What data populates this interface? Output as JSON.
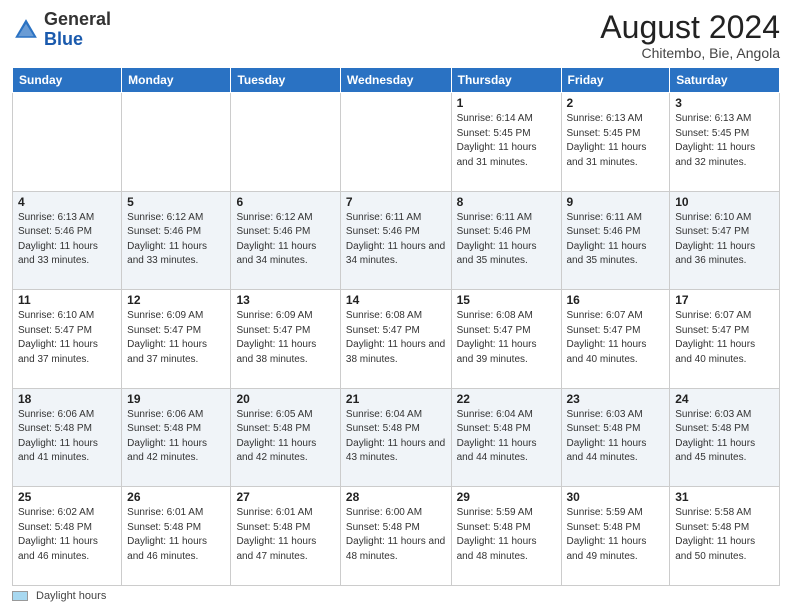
{
  "header": {
    "logo_line1": "General",
    "logo_line2": "Blue",
    "month_year": "August 2024",
    "location": "Chitembo, Bie, Angola"
  },
  "days_of_week": [
    "Sunday",
    "Monday",
    "Tuesday",
    "Wednesday",
    "Thursday",
    "Friday",
    "Saturday"
  ],
  "weeks": [
    [
      {
        "day": "",
        "info": ""
      },
      {
        "day": "",
        "info": ""
      },
      {
        "day": "",
        "info": ""
      },
      {
        "day": "",
        "info": ""
      },
      {
        "day": "1",
        "info": "Sunrise: 6:14 AM\nSunset: 5:45 PM\nDaylight: 11 hours\nand 31 minutes."
      },
      {
        "day": "2",
        "info": "Sunrise: 6:13 AM\nSunset: 5:45 PM\nDaylight: 11 hours\nand 31 minutes."
      },
      {
        "day": "3",
        "info": "Sunrise: 6:13 AM\nSunset: 5:45 PM\nDaylight: 11 hours\nand 32 minutes."
      }
    ],
    [
      {
        "day": "4",
        "info": "Sunrise: 6:13 AM\nSunset: 5:46 PM\nDaylight: 11 hours\nand 33 minutes."
      },
      {
        "day": "5",
        "info": "Sunrise: 6:12 AM\nSunset: 5:46 PM\nDaylight: 11 hours\nand 33 minutes."
      },
      {
        "day": "6",
        "info": "Sunrise: 6:12 AM\nSunset: 5:46 PM\nDaylight: 11 hours\nand 34 minutes."
      },
      {
        "day": "7",
        "info": "Sunrise: 6:11 AM\nSunset: 5:46 PM\nDaylight: 11 hours\nand 34 minutes."
      },
      {
        "day": "8",
        "info": "Sunrise: 6:11 AM\nSunset: 5:46 PM\nDaylight: 11 hours\nand 35 minutes."
      },
      {
        "day": "9",
        "info": "Sunrise: 6:11 AM\nSunset: 5:46 PM\nDaylight: 11 hours\nand 35 minutes."
      },
      {
        "day": "10",
        "info": "Sunrise: 6:10 AM\nSunset: 5:47 PM\nDaylight: 11 hours\nand 36 minutes."
      }
    ],
    [
      {
        "day": "11",
        "info": "Sunrise: 6:10 AM\nSunset: 5:47 PM\nDaylight: 11 hours\nand 37 minutes."
      },
      {
        "day": "12",
        "info": "Sunrise: 6:09 AM\nSunset: 5:47 PM\nDaylight: 11 hours\nand 37 minutes."
      },
      {
        "day": "13",
        "info": "Sunrise: 6:09 AM\nSunset: 5:47 PM\nDaylight: 11 hours\nand 38 minutes."
      },
      {
        "day": "14",
        "info": "Sunrise: 6:08 AM\nSunset: 5:47 PM\nDaylight: 11 hours\nand 38 minutes."
      },
      {
        "day": "15",
        "info": "Sunrise: 6:08 AM\nSunset: 5:47 PM\nDaylight: 11 hours\nand 39 minutes."
      },
      {
        "day": "16",
        "info": "Sunrise: 6:07 AM\nSunset: 5:47 PM\nDaylight: 11 hours\nand 40 minutes."
      },
      {
        "day": "17",
        "info": "Sunrise: 6:07 AM\nSunset: 5:47 PM\nDaylight: 11 hours\nand 40 minutes."
      }
    ],
    [
      {
        "day": "18",
        "info": "Sunrise: 6:06 AM\nSunset: 5:48 PM\nDaylight: 11 hours\nand 41 minutes."
      },
      {
        "day": "19",
        "info": "Sunrise: 6:06 AM\nSunset: 5:48 PM\nDaylight: 11 hours\nand 42 minutes."
      },
      {
        "day": "20",
        "info": "Sunrise: 6:05 AM\nSunset: 5:48 PM\nDaylight: 11 hours\nand 42 minutes."
      },
      {
        "day": "21",
        "info": "Sunrise: 6:04 AM\nSunset: 5:48 PM\nDaylight: 11 hours\nand 43 minutes."
      },
      {
        "day": "22",
        "info": "Sunrise: 6:04 AM\nSunset: 5:48 PM\nDaylight: 11 hours\nand 44 minutes."
      },
      {
        "day": "23",
        "info": "Sunrise: 6:03 AM\nSunset: 5:48 PM\nDaylight: 11 hours\nand 44 minutes."
      },
      {
        "day": "24",
        "info": "Sunrise: 6:03 AM\nSunset: 5:48 PM\nDaylight: 11 hours\nand 45 minutes."
      }
    ],
    [
      {
        "day": "25",
        "info": "Sunrise: 6:02 AM\nSunset: 5:48 PM\nDaylight: 11 hours\nand 46 minutes."
      },
      {
        "day": "26",
        "info": "Sunrise: 6:01 AM\nSunset: 5:48 PM\nDaylight: 11 hours\nand 46 minutes."
      },
      {
        "day": "27",
        "info": "Sunrise: 6:01 AM\nSunset: 5:48 PM\nDaylight: 11 hours\nand 47 minutes."
      },
      {
        "day": "28",
        "info": "Sunrise: 6:00 AM\nSunset: 5:48 PM\nDaylight: 11 hours\nand 48 minutes."
      },
      {
        "day": "29",
        "info": "Sunrise: 5:59 AM\nSunset: 5:48 PM\nDaylight: 11 hours\nand 48 minutes."
      },
      {
        "day": "30",
        "info": "Sunrise: 5:59 AM\nSunset: 5:48 PM\nDaylight: 11 hours\nand 49 minutes."
      },
      {
        "day": "31",
        "info": "Sunrise: 5:58 AM\nSunset: 5:48 PM\nDaylight: 11 hours\nand 50 minutes."
      }
    ]
  ],
  "footer": {
    "legend_label": "Daylight hours"
  }
}
